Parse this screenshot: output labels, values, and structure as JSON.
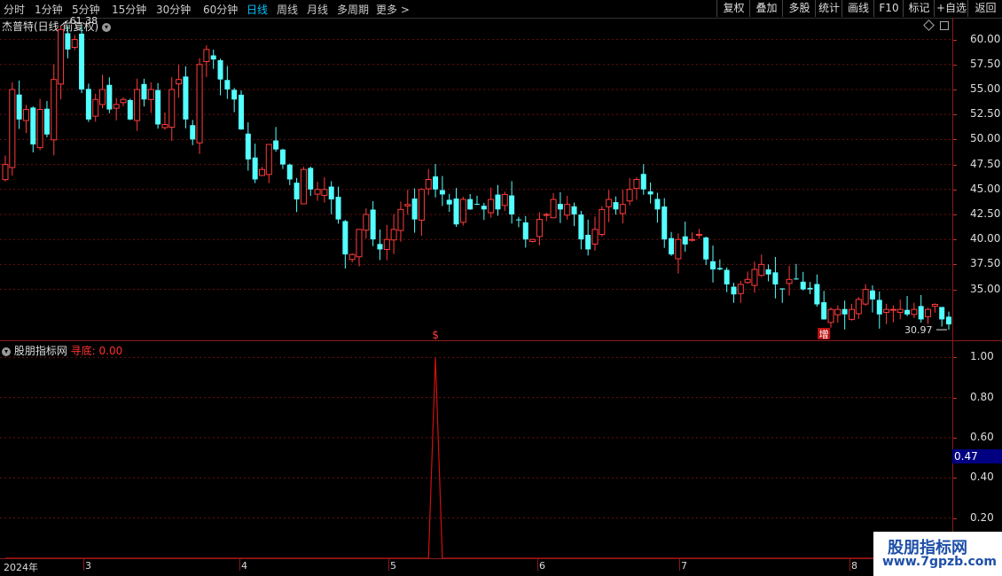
{
  "toolbar": {
    "periods": [
      "分时",
      "1分钟",
      "5分钟",
      "15分钟",
      "30分钟",
      "60分钟",
      "日线",
      "周线",
      "月线",
      "多周期",
      "更多 >"
    ],
    "active_period": "日线",
    "tools": [
      "复权",
      "叠加",
      "多股",
      "统计",
      "画线",
      "F10",
      "标记",
      "+自选",
      "返回"
    ]
  },
  "main": {
    "title": "杰普特(日线 前复权)",
    "high_label": "61.38",
    "low_label": "30.97",
    "signal_dollar": "$",
    "signal_zeng": "增",
    "y_labels": [
      "60.00",
      "57.50",
      "55.00",
      "52.50",
      "50.00",
      "47.50",
      "45.00",
      "42.50",
      "40.00",
      "37.50",
      "35.00"
    ]
  },
  "indicator": {
    "name": "股朋指标网",
    "series_label": "寻底:",
    "series_value": "0.00",
    "y_labels": [
      "1.00",
      "0.80",
      "0.60",
      "0.40",
      "0.20"
    ],
    "current_value": "0.47"
  },
  "x_axis": {
    "labels": [
      "2024年",
      "3",
      "4",
      "5",
      "6",
      "7",
      "8"
    ]
  },
  "watermark": {
    "line1": "股朋指标网",
    "line2": "www.7gpzb.com"
  },
  "colors": {
    "up": "#ff3b3b",
    "down": "#54ffff",
    "grid": "#6b1010",
    "indicator_line": "#d01010",
    "active_period": "#00c4ff"
  },
  "chart_data": {
    "type": "candlestick",
    "ylim": [
      30,
      62
    ],
    "high": 61.38,
    "low": 30.97,
    "closes": [
      47.5,
      55,
      52,
      53,
      49.5,
      53,
      50.5,
      56,
      61,
      59,
      60,
      55,
      52,
      54,
      55,
      53,
      53.5,
      54,
      52,
      55,
      54,
      55,
      51.5,
      51.5,
      55,
      56,
      52,
      50,
      57.5,
      59,
      58,
      56,
      55,
      54,
      51,
      48,
      46,
      47,
      49.5,
      49,
      47.5,
      46,
      44,
      47,
      45,
      45,
      45,
      44,
      42,
      38.5,
      38.5,
      41,
      42.5,
      40,
      39,
      40,
      41,
      43,
      43.5,
      42,
      45,
      46,
      45,
      44.5,
      43.5,
      41.5,
      44,
      43,
      43.5,
      43,
      44,
      43,
      44.5,
      42.5,
      42,
      40,
      40,
      42,
      42.5,
      44,
      43,
      43.5,
      42.5,
      40,
      39,
      41,
      43,
      44,
      43,
      43.5,
      45,
      46,
      45,
      44.5,
      43,
      40,
      38.5,
      40,
      39.5,
      40,
      40.5,
      38,
      37,
      37,
      35.5,
      34.5,
      35.5,
      36,
      37,
      37.5,
      36.5,
      35.5,
      35,
      36,
      36,
      35,
      35,
      33.5,
      32,
      33,
      33,
      32.5,
      33,
      34,
      35,
      34,
      32.5,
      33,
      33,
      33,
      32.5,
      33,
      32,
      33,
      33.5,
      32,
      31.5
    ],
    "signals": [
      "$",
      "增"
    ],
    "indicator": {
      "name": "寻底",
      "ylim": [
        0,
        1.05
      ],
      "values_note_peak": 1.0,
      "peak_index": 62,
      "value_current": 0.0
    }
  }
}
